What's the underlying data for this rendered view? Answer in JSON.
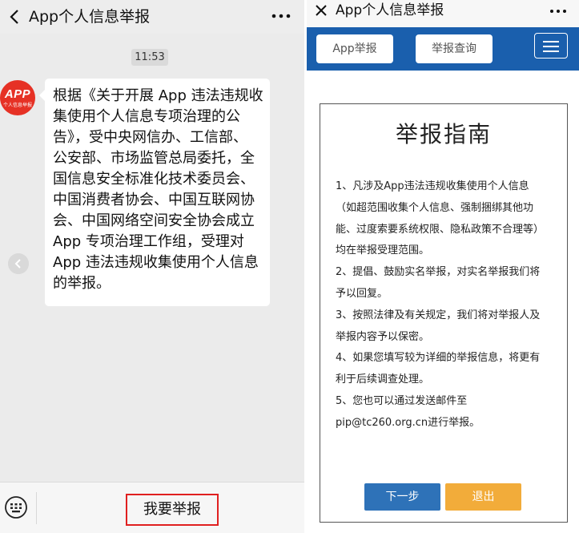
{
  "chat": {
    "title": "App个人信息举报",
    "time": "11:53",
    "avatar_logo": "APP",
    "avatar_caption": "个人信息举报",
    "message_lines": [
      "根据《关于开展 App 违法违规收",
      "集使用个人信息专项治理的公",
      "告》，受中央网信办、工信部、",
      "公安部、市场监管总局委托，全",
      "国信息安全标准化技术委员会、",
      "中国消费者协会、中国互联网协",
      "会、中国网络空间安全协会成立",
      "App 专项治理工作组，受理对",
      "App 违法违规收集使用个人信息",
      "的举报。"
    ],
    "report_button": "我要举报"
  },
  "web": {
    "title": "App个人信息举报",
    "nav": {
      "app_report": "App举报",
      "report_query": "举报查询"
    },
    "guide": {
      "title": "举报指南",
      "lines": [
        "1、凡涉及App违法违规收集使用个人信息",
        "（如超范围收集个人信息、强制捆绑其他功",
        "能、过度索要系统权限、隐私政策不合理等）",
        "均在举报受理范围。",
        "2、提倡、鼓励实名举报，对实名举报我们将",
        "予以回复。",
        "3、按照法律及有关规定，我们将对举报人及",
        "举报内容予以保密。",
        "4、如果您填写较为详细的举报信息，将更有",
        "利于后续调查处理。",
        "5、您也可以通过发送邮件至",
        "pip@tc260.org.cn进行举报。"
      ],
      "next_button": "下一步",
      "exit_button": "退出"
    }
  },
  "colors": {
    "nav_blue": "#1a5fad",
    "next_blue": "#2e72b8",
    "exit_orange": "#f2ac3a",
    "highlight_red": "#e02020",
    "avatar_red": "#e63125"
  },
  "icons": [
    "back-icon",
    "more-icon",
    "keyboard-icon",
    "close-icon",
    "menu-icon",
    "collapse-arrow-icon"
  ]
}
